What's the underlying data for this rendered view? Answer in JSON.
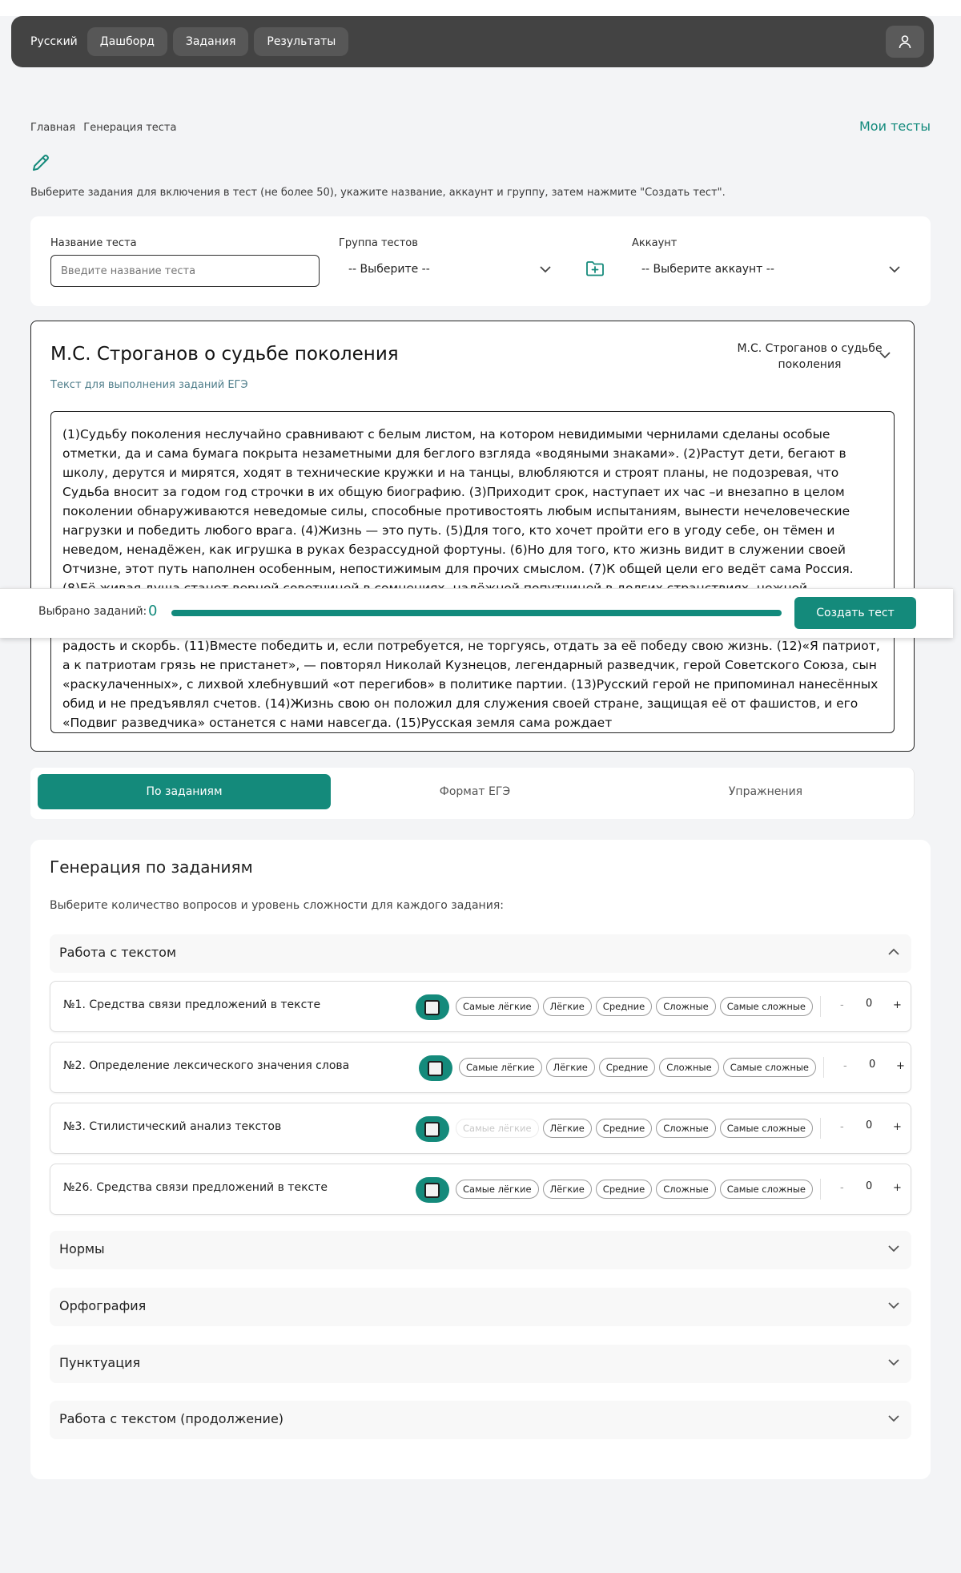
{
  "nav": {
    "language": "Русский",
    "items": [
      "Дашборд",
      "Задания",
      "Результаты"
    ],
    "user_icon": "user-icon"
  },
  "breadcrumb": {
    "home": "Главная",
    "current": "Генерация теста"
  },
  "my_tests_link": "Мои тесты",
  "edit_icon": "pencil-icon",
  "instructions": "Выберите задания для включения в тест (не более 50), укажите название, аккаунт и группу, затем нажмите \"Создать тест\".",
  "form": {
    "name_label": "Название теста",
    "name_placeholder": "Введите название теста",
    "group_label": "Группа тестов",
    "group_value": "-- Выберите --",
    "account_label": "Аккаунт",
    "account_value": "-- Выберите аккаунт --"
  },
  "text_card": {
    "title": "М.С. Строганов о судьбе поколения",
    "subtitle": "Текст для выполнения заданий ЕГЭ",
    "select_value": "М.С. Строганов о судьбе поколения",
    "body": "(1)Судьбу поколения неслучайно сравнивают с белым листом, на котором невидимыми чернилами сделаны особые отметки, да и сама бумага покрыта незаметными для беглого взгляда «водяными знаками». (2)Растут дети, бегают в школу, дерутся и мирятся, ходят в технические кружки и на танцы, влюбляются и строят планы, не подозревая, что Судьба вносит за годом год строчки в их общую биографию. (3)Приходит срок, наступает их час –и внезапно в целом поколении обнаруживаются неведомые силы, способные противостоять любым испытаниям, вынести нечеловеческие нагрузки и победить любого врага. (4)Жизнь — это путь. (5)Для того, кто хочет пройти его в угоду себе, он тёмен и неведом, ненадёжен, как игрушка в руках безрассудной фортуны. (6)Но для того, кто жизнь видит в служении своей Отчизне, этот путь наполнен особенным, непостижимым для прочих смыслом. (7)К общей цели его ведёт сама Россия. (8)Её живая душа станет верной советчицей в сомнениях, надёжной попутчицей в долгих странствиях, нежной утешительницей в горе, преданнейшей помощницей в делах. (9)Эти люди не выбирают свою Родину, они её принимают как данность. (10)Им не дано изменить судьбу: жизнью уготовано им жить одной судьбой, разделять со страной её радость и скорбь. (11)Вместе победить и, если потребуется, не торгуясь, отдать за её победу свою жизнь. (12)«Я патриот, а к патриотам грязь не пристанет», — повторял Николай Кузнецов, легендарный разведчик, герой Советского Союза, сын «раскулаченных», с лихвой хлебнувший «от перегибов» в политике партии. (13)Русский герой не припоминал нанесённых обид и не предъявлял счетов. (14)Жизнь свою он положил для служения своей стране, защищая её от фашистов, и его «Подвиг разведчика» останется с нами навсегда. (15)Русская земля сама рождает"
  },
  "selection_bar": {
    "label": "Выбрано заданий:",
    "count": "0",
    "button": "Создать тест"
  },
  "tabs": [
    {
      "label": "По заданиям",
      "active": true
    },
    {
      "label": "Формат ЕГЭ",
      "active": false
    },
    {
      "label": "Упражнения",
      "active": false
    }
  ],
  "generation": {
    "title": "Генерация по заданиям",
    "subtitle": "Выберите количество вопросов и уровень сложности для каждого задания:",
    "sections": [
      {
        "label": "Работа с текстом",
        "expanded": true
      },
      {
        "label": "Нормы",
        "expanded": false
      },
      {
        "label": "Орфография",
        "expanded": false
      },
      {
        "label": "Пунктуация",
        "expanded": false
      },
      {
        "label": "Работа с текстом (продолжение)",
        "expanded": false
      }
    ],
    "difficulty_levels": [
      "Самые лёгкие",
      "Лёгкие",
      "Средние",
      "Сложные",
      "Самые сложные"
    ],
    "tasks": [
      {
        "label": "№1. Средства связи предложений в тексте",
        "count": "0",
        "disabled_level": null
      },
      {
        "label": "№2. Определение лексического значения слова",
        "count": "0",
        "disabled_level": null
      },
      {
        "label": "№3. Стилистический анализ текстов",
        "count": "0",
        "disabled_level": "Самые лёгкие"
      },
      {
        "label": "№26. Средства связи предложений в тексте",
        "count": "0",
        "disabled_level": null
      }
    ],
    "minus": "-",
    "plus": "+"
  },
  "colors": {
    "accent": "#148a7b",
    "nav_bg": "#434343",
    "page_bg": "#f3f4f6"
  }
}
